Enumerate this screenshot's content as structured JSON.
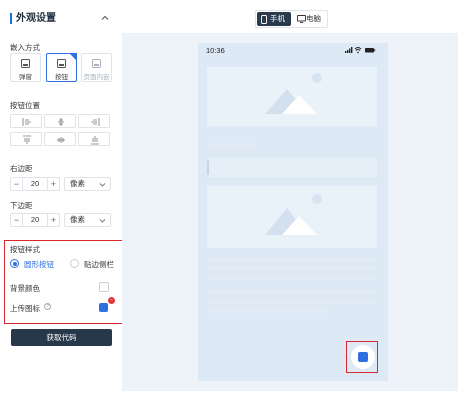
{
  "panel": {
    "title": "外观设置"
  },
  "embed_mode": {
    "label": "嵌入方式",
    "options": [
      {
        "label": "弹窗",
        "icon": "popup-icon",
        "selected": false,
        "disabled": false
      },
      {
        "label": "按钮",
        "icon": "button-icon",
        "selected": true,
        "disabled": false
      },
      {
        "label": "页面内嵌",
        "icon": "embed-page-icon",
        "selected": false,
        "disabled": true
      }
    ]
  },
  "button_position": {
    "label": "按钮位置"
  },
  "right_margin": {
    "label": "右边距",
    "minus": "−",
    "value": "20",
    "plus": "+",
    "unit": "像素"
  },
  "bottom_margin": {
    "label": "下边距",
    "minus": "−",
    "value": "20",
    "plus": "+",
    "unit": "像素"
  },
  "button_style": {
    "label": "按钮样式",
    "options": [
      {
        "label": "圆形按钮",
        "selected": true
      },
      {
        "label": "贴边侧栏",
        "selected": false
      }
    ],
    "bg_color_label": "背景颜色",
    "upload_icon_label": "上传图标",
    "help_icon": "?",
    "badge": "−"
  },
  "actions": {
    "get_code": "获取代码"
  },
  "preview": {
    "tabs": [
      {
        "label": "手机",
        "active": true
      },
      {
        "label": "电脑",
        "active": false
      }
    ],
    "status_time": "10:36"
  },
  "colors": {
    "accent": "#2f6fe0",
    "dark_button": "#27384a",
    "highlight": "#d9272e"
  }
}
